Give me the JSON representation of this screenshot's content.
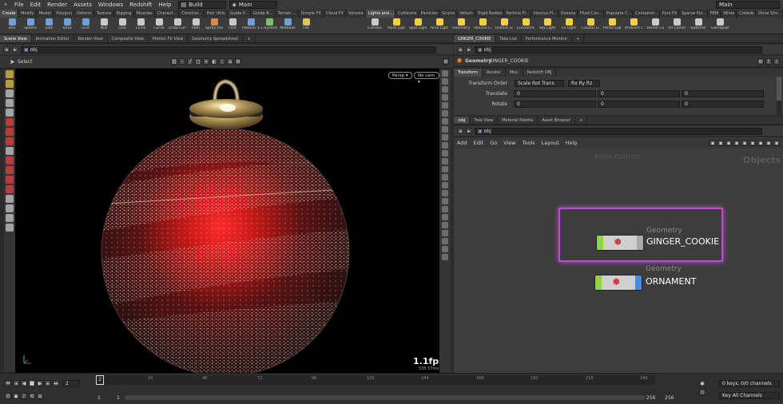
{
  "menubar": {
    "items": [
      "File",
      "Edit",
      "Render",
      "Assets",
      "Windows",
      "Redshift",
      "Help"
    ],
    "desktop": "Build",
    "session": "Main",
    "right_session": "Main"
  },
  "shelf": {
    "tabs_left": [
      "Create",
      "Modify",
      "Model",
      "Polygon",
      "Deform",
      "Texture",
      "Rigging",
      "Muscles",
      "Charact...",
      "Constrai...",
      "Hair Utils",
      "Guide P...",
      "Guide B...",
      "Terrain ...",
      "Simple FX",
      "Cloud FX",
      "Volume"
    ],
    "tabs_right": [
      "Lights and ...",
      "Collisions",
      "Particles",
      "Grains",
      "Vellum",
      "Rigid Bodies",
      "Particle Fl...",
      "Viscous Fl...",
      "Oceans",
      "Fluid Con...",
      "Populate C...",
      "Container...",
      "Pyro FX",
      "Sparse Pyr...",
      "FEM",
      "Wires",
      "Crowds",
      "Drive Sim..."
    ],
    "tools_left": [
      {
        "label": "Box",
        "icon": "box-icon",
        "color": "#6fa0d8"
      },
      {
        "label": "Sphere",
        "icon": "sphere-icon",
        "color": "#6fa0d8"
      },
      {
        "label": "Tube",
        "icon": "tube-icon",
        "color": "#6fa0d8"
      },
      {
        "label": "Torus",
        "icon": "torus-icon",
        "color": "#6fa0d8"
      },
      {
        "label": "Grid",
        "icon": "grid-icon",
        "color": "#6fa0d8"
      },
      {
        "label": "Null",
        "icon": "null-icon",
        "color": "#c8c8c8"
      },
      {
        "label": "Line",
        "icon": "line-icon",
        "color": "#c8c8c8"
      },
      {
        "label": "Circle",
        "icon": "circle-icon",
        "color": "#c8c8c8"
      },
      {
        "label": "Curve",
        "icon": "curve-icon",
        "color": "#c8c8c8"
      },
      {
        "label": "Draw Curve",
        "icon": "draw-curve-icon",
        "color": "#c8c8c8"
      },
      {
        "label": "Path",
        "icon": "path-icon",
        "color": "#c8c8c8"
      },
      {
        "label": "Spray Paint",
        "icon": "spray-paint-icon",
        "color": "#d88a4a"
      },
      {
        "label": "Font",
        "icon": "font-icon",
        "color": "#c8c8c8"
      },
      {
        "label": "Platonic Solids",
        "icon": "platonic-icon",
        "color": "#6fa0d8"
      },
      {
        "label": "L-System",
        "icon": "lsystem-icon",
        "color": "#7ac06a"
      },
      {
        "label": "Metaball",
        "icon": "metaball-icon",
        "color": "#6fa0d8"
      },
      {
        "label": "File",
        "icon": "file-icon",
        "color": "#e0c060"
      }
    ],
    "tools_right": [
      {
        "label": "Camera",
        "icon": "camera-icon",
        "color": "#c8c8c8"
      },
      {
        "label": "Point Light",
        "icon": "point-light-icon",
        "color": "#f0d040"
      },
      {
        "label": "Spot Light",
        "icon": "spot-light-icon",
        "color": "#f0d040"
      },
      {
        "label": "Area Light",
        "icon": "area-light-icon",
        "color": "#f0d040"
      },
      {
        "label": "Geometry Light",
        "icon": "geometry-light-icon",
        "color": "#f0d040"
      },
      {
        "label": "Volume Light",
        "icon": "volume-light-icon",
        "color": "#f0d040"
      },
      {
        "label": "Distant Light",
        "icon": "distant-light-icon",
        "color": "#f0d040"
      },
      {
        "label": "Environment Light",
        "icon": "environment-light-icon",
        "color": "#f0d040"
      },
      {
        "label": "Sky Light",
        "icon": "sky-light-icon",
        "color": "#f0d040"
      },
      {
        "label": "GI Light",
        "icon": "gi-light-icon",
        "color": "#f0d040"
      },
      {
        "label": "Caustic Light",
        "icon": "caustic-light-icon",
        "color": "#f0d040"
      },
      {
        "label": "Portal Light",
        "icon": "portal-light-icon",
        "color": "#f0d040"
      },
      {
        "label": "Ambient Light",
        "icon": "ambient-light-icon",
        "color": "#f0d040"
      },
      {
        "label": "Stereo Camera",
        "icon": "stereo-camera-icon",
        "color": "#c8c8c8"
      },
      {
        "label": "VR Camera",
        "icon": "vr-camera-icon",
        "color": "#c8c8c8"
      },
      {
        "label": "Switcher",
        "icon": "switcher-icon",
        "color": "#c8c8c8"
      },
      {
        "label": "Gamepad Camera",
        "icon": "gamepad-camera-icon",
        "color": "#c8c8c8"
      }
    ]
  },
  "left_panel": {
    "tabs": [
      "Scene View",
      "Animation Editor",
      "Render View",
      "Composite View",
      "Motion FX View",
      "Geometry Spreadsheet"
    ],
    "path": "obj",
    "tool_label": "Select",
    "persp": "Persp",
    "cam": "No cam",
    "fps": "1.1fps",
    "ms": "535.57ms"
  },
  "right_top": {
    "tabs": [
      "GINGER_COOKIE",
      "Take List",
      "Performance Monitor"
    ],
    "path": "obj",
    "node_type": "Geometry",
    "node_name": "GINGER_COOKIE",
    "param_tabs": [
      "Transform",
      "Render",
      "Misc",
      "Redshift OBJ"
    ],
    "transform_order_label": "Transform Order",
    "transform_order": "Scale Rot Trans",
    "rot_order": "Rx Ry Rz",
    "translate_label": "Translate",
    "rotate_label": "Rotate",
    "translate": [
      "0",
      "0",
      "0"
    ],
    "rotate": [
      "0",
      "0",
      "0"
    ]
  },
  "right_bottom": {
    "tabs": [
      "/obj",
      "Tree View",
      "Material Palette",
      "Asset Browser"
    ],
    "path": "obj",
    "menu": [
      "Add",
      "Edit",
      "Go",
      "View",
      "Tools",
      "Layout",
      "Help"
    ],
    "watermark": "Indie Edition",
    "context": "Objects",
    "nodes": [
      {
        "type": "Geometry",
        "name": "GINGER_COOKIE",
        "color": "#8fd63e",
        "selected": true
      },
      {
        "type": "Geometry",
        "name": "ORNAMENT",
        "color": "#8fd63e",
        "selected": false
      }
    ]
  },
  "timeline": {
    "current_frame": "2",
    "ticks": [
      "2",
      "24",
      "48",
      "72",
      "96",
      "120",
      "144",
      "168",
      "192",
      "216",
      "240"
    ],
    "start": "1",
    "start2": "1",
    "end": "256",
    "end2": "256",
    "keys_info": "0 keys, 0/0 channels",
    "key_all": "Key All Channels"
  },
  "colors": {
    "accent_selected": "#c04ad8",
    "node_geo": "#8fd63e",
    "ornament_red": "#d42020"
  }
}
